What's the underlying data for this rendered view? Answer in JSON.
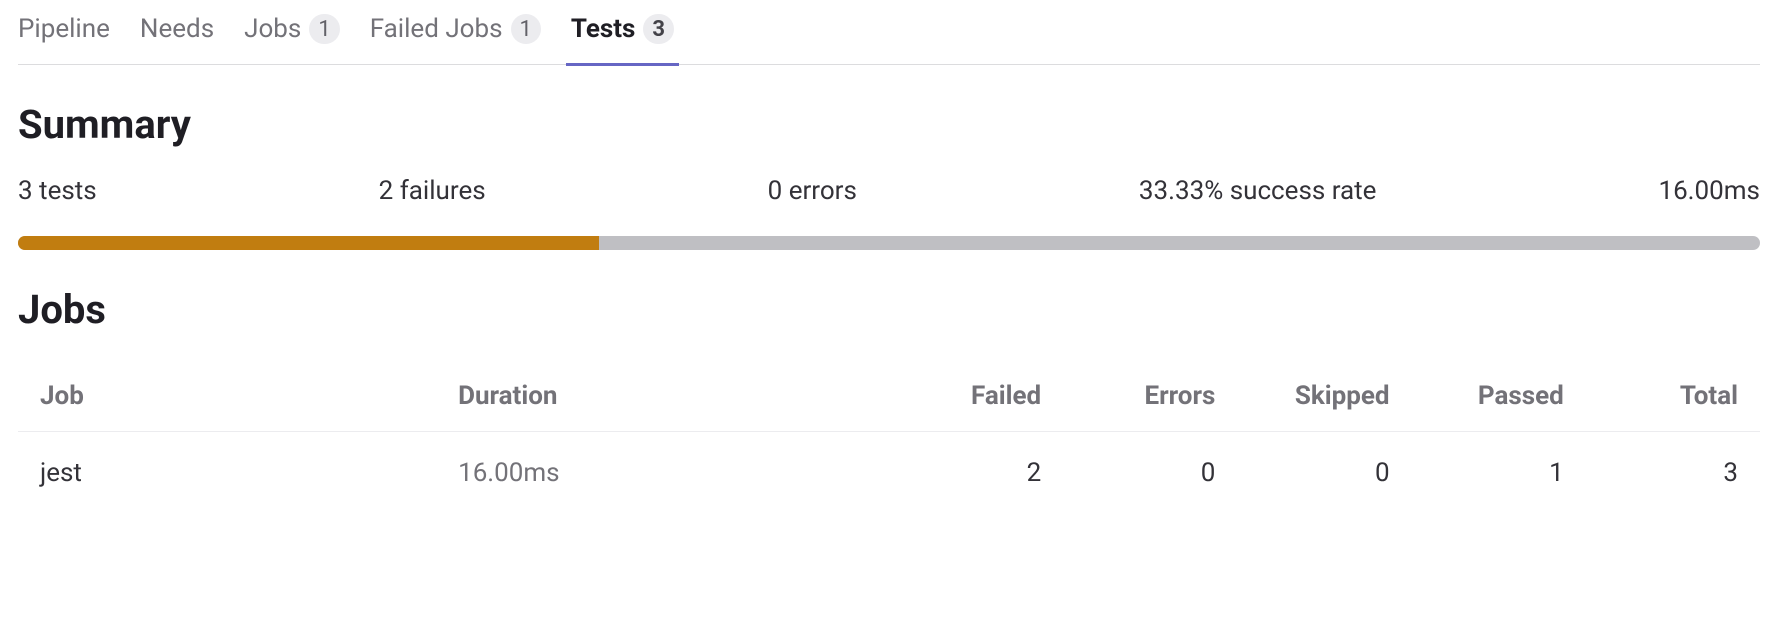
{
  "tabs": [
    {
      "label": "Pipeline",
      "badge": null,
      "active": false
    },
    {
      "label": "Needs",
      "badge": null,
      "active": false
    },
    {
      "label": "Jobs",
      "badge": "1",
      "active": false
    },
    {
      "label": "Failed Jobs",
      "badge": "1",
      "active": false
    },
    {
      "label": "Tests",
      "badge": "3",
      "active": true
    }
  ],
  "headings": {
    "summary": "Summary",
    "jobs": "Jobs"
  },
  "summary": {
    "tests": "3 tests",
    "failures": "2 failures",
    "errors": "0 errors",
    "success_rate": "33.33% success rate",
    "duration": "16.00ms",
    "progress_percent": 33.33
  },
  "jobs_table": {
    "headers": {
      "job": "Job",
      "duration": "Duration",
      "failed": "Failed",
      "errors": "Errors",
      "skipped": "Skipped",
      "passed": "Passed",
      "total": "Total"
    },
    "rows": [
      {
        "job": "jest",
        "duration": "16.00ms",
        "failed": "2",
        "errors": "0",
        "skipped": "0",
        "passed": "1",
        "total": "3"
      }
    ]
  }
}
